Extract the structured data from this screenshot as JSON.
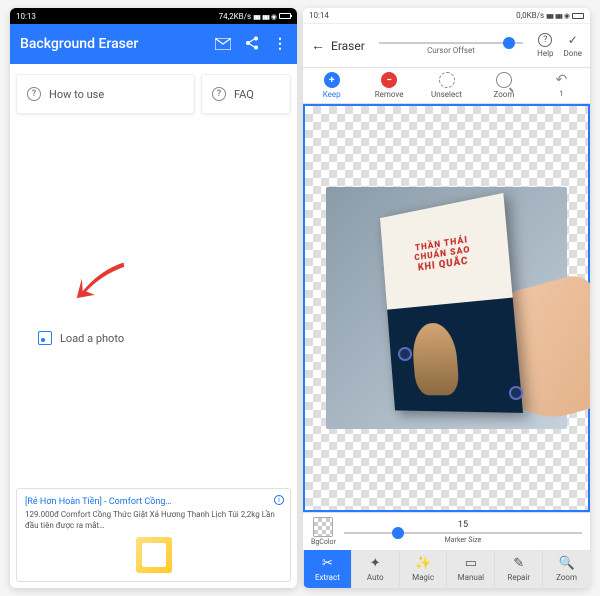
{
  "left": {
    "status": {
      "time": "10:13",
      "network": "74,2KB/s"
    },
    "header": {
      "title": "Background Eraser"
    },
    "how_to_use": "How to use",
    "faq": "FAQ",
    "load_photo": "Load a photo",
    "ad": {
      "title": "[Rẻ Hơn Hoàn Tiền] - Comfort Cồng…",
      "desc": "129.000đ Comfort Cồng Thức Giặt Xả Hương Thanh Lịch Túi 2,2kg Lần đầu tiên được ra mắt…"
    }
  },
  "right": {
    "status": {
      "time": "10:14",
      "network": "0,0KB/s"
    },
    "header": {
      "title": "Eraser",
      "cursor_offset": "Cursor Offset",
      "help": "Help",
      "done": "Done"
    },
    "tools": {
      "keep": "Keep",
      "remove": "Remove",
      "unselect": "Unselect",
      "zoom": "Zoom"
    },
    "book": {
      "line1": "THẦN THÁI",
      "line2": "CHUẨN SAO",
      "line3": "KHI QUẮC"
    },
    "bottom": {
      "bgcolor": "BgColor",
      "marker_val": "15",
      "marker_size": "Marker Size"
    },
    "tabs": {
      "extract": "Extract",
      "auto": "Auto",
      "magic": "Magic",
      "manual": "Manual",
      "repair": "Repair",
      "zoom": "Zoom"
    }
  }
}
